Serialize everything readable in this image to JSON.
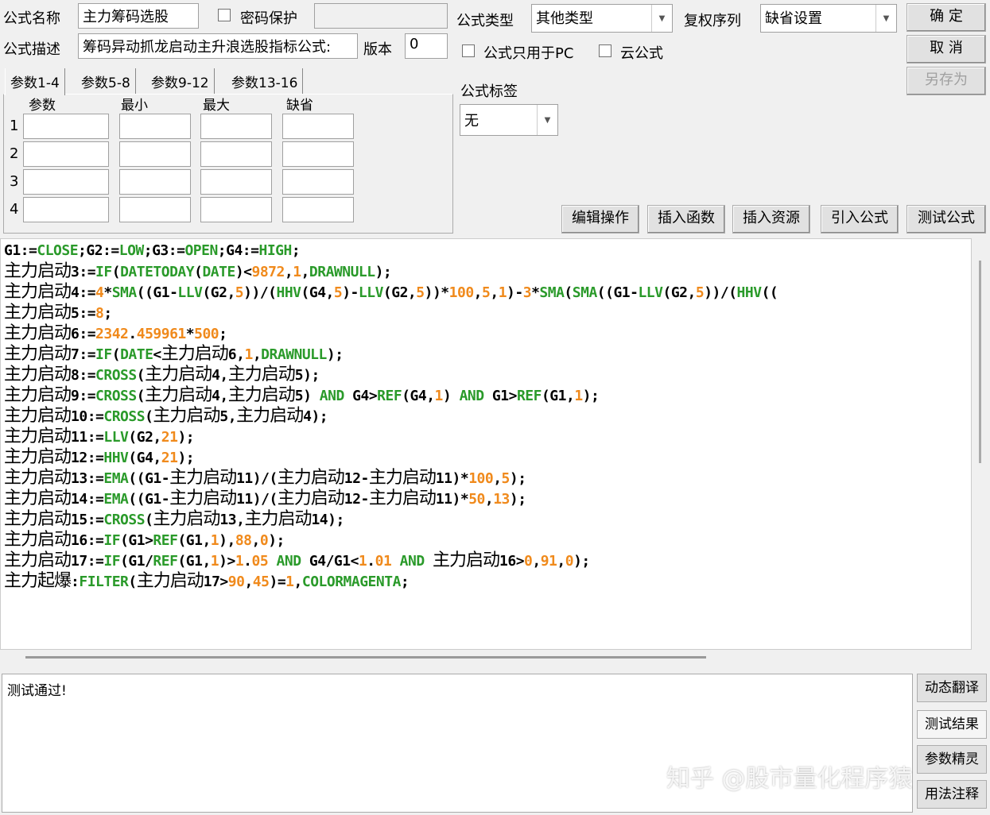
{
  "header": {
    "name_label": "公式名称",
    "name_value": "主力筹码选股",
    "password_label": "密码保护",
    "password_value": "",
    "desc_label": "公式描述",
    "desc_value": "筹码异动抓龙启动主升浪选股指标公式:",
    "version_label": "版本",
    "version_value": "0",
    "type_label": "公式类型",
    "type_value": "其他类型",
    "restore_label": "复权序列",
    "restore_value": "缺省设置",
    "pc_only_label": "公式只用于PC",
    "cloud_label": "云公式",
    "tag_label": "公式标签",
    "tag_value": "无",
    "ok": "确 定",
    "cancel": "取 消",
    "save_as": "另存为"
  },
  "params": {
    "tabs": [
      "参数1-4",
      "参数5-8",
      "参数9-12",
      "参数13-16"
    ],
    "columns": [
      "参数",
      "最小",
      "最大",
      "缺省"
    ],
    "rows": [
      "1",
      "2",
      "3",
      "4"
    ]
  },
  "toolbar": [
    "编辑操作",
    "插入函数",
    "插入资源",
    "引入公式",
    "测试公式"
  ],
  "code": [
    [
      [
        "k",
        "G1:="
      ],
      [
        "f",
        "CLOSE"
      ],
      [
        "k",
        ";G2:="
      ],
      [
        "f",
        "LOW"
      ],
      [
        "k",
        ";G3:="
      ],
      [
        "f",
        "OPEN"
      ],
      [
        "k",
        ";G4:="
      ],
      [
        "f",
        "HIGH"
      ],
      [
        "k",
        ";"
      ]
    ],
    [
      [
        "cn",
        "主力启动"
      ],
      [
        "k",
        "3:="
      ],
      [
        "f",
        "IF"
      ],
      [
        "k",
        "("
      ],
      [
        "f",
        "DATETODAY"
      ],
      [
        "k",
        "("
      ],
      [
        "f",
        "DATE"
      ],
      [
        "k",
        ")<"
      ],
      [
        "n",
        "9872"
      ],
      [
        "k",
        ","
      ],
      [
        "n",
        "1"
      ],
      [
        "k",
        ","
      ],
      [
        "f",
        "DRAWNULL"
      ],
      [
        "k",
        ");"
      ]
    ],
    [
      [
        "cn",
        "主力启动"
      ],
      [
        "k",
        "4:="
      ],
      [
        "n",
        "4"
      ],
      [
        "k",
        "*"
      ],
      [
        "f",
        "SMA"
      ],
      [
        "k",
        "((G1-"
      ],
      [
        "f",
        "LLV"
      ],
      [
        "k",
        "(G2,"
      ],
      [
        "n",
        "5"
      ],
      [
        "k",
        "))/("
      ],
      [
        "f",
        "HHV"
      ],
      [
        "k",
        "(G4,"
      ],
      [
        "n",
        "5"
      ],
      [
        "k",
        ")-"
      ],
      [
        "f",
        "LLV"
      ],
      [
        "k",
        "(G2,"
      ],
      [
        "n",
        "5"
      ],
      [
        "k",
        "))*"
      ],
      [
        "n",
        "100"
      ],
      [
        "k",
        ","
      ],
      [
        "n",
        "5"
      ],
      [
        "k",
        ","
      ],
      [
        "n",
        "1"
      ],
      [
        "k",
        ")-"
      ],
      [
        "n",
        "3"
      ],
      [
        "k",
        "*"
      ],
      [
        "f",
        "SMA"
      ],
      [
        "k",
        "("
      ],
      [
        "f",
        "SMA"
      ],
      [
        "k",
        "((G1-"
      ],
      [
        "f",
        "LLV"
      ],
      [
        "k",
        "(G2,"
      ],
      [
        "n",
        "5"
      ],
      [
        "k",
        "))/("
      ],
      [
        "f",
        "HHV"
      ],
      [
        "k",
        "(("
      ]
    ],
    [
      [
        "cn",
        "主力启动"
      ],
      [
        "k",
        "5:="
      ],
      [
        "n",
        "8"
      ],
      [
        "k",
        ";"
      ]
    ],
    [
      [
        "cn",
        "主力启动"
      ],
      [
        "k",
        "6:="
      ],
      [
        "n",
        "2342"
      ],
      [
        "k",
        "."
      ],
      [
        "n",
        "459961"
      ],
      [
        "k",
        "*"
      ],
      [
        "n",
        "500"
      ],
      [
        "k",
        ";"
      ]
    ],
    [
      [
        "cn",
        "主力启动"
      ],
      [
        "k",
        "7:="
      ],
      [
        "f",
        "IF"
      ],
      [
        "k",
        "("
      ],
      [
        "f",
        "DATE"
      ],
      [
        "k",
        "<"
      ],
      [
        "cn",
        "主力启动"
      ],
      [
        "k",
        "6,"
      ],
      [
        "n",
        "1"
      ],
      [
        "k",
        ","
      ],
      [
        "f",
        "DRAWNULL"
      ],
      [
        "k",
        ");"
      ]
    ],
    [
      [
        "cn",
        "主力启动"
      ],
      [
        "k",
        "8:="
      ],
      [
        "f",
        "CROSS"
      ],
      [
        "k",
        "("
      ],
      [
        "cn",
        "主力启动"
      ],
      [
        "k",
        "4,"
      ],
      [
        "cn",
        "主力启动"
      ],
      [
        "k",
        "5);"
      ]
    ],
    [
      [
        "cn",
        "主力启动"
      ],
      [
        "k",
        "9:="
      ],
      [
        "f",
        "CROSS"
      ],
      [
        "k",
        "("
      ],
      [
        "cn",
        "主力启动"
      ],
      [
        "k",
        "4,"
      ],
      [
        "cn",
        "主力启动"
      ],
      [
        "k",
        "5) "
      ],
      [
        "f",
        "AND"
      ],
      [
        "k",
        " G4>"
      ],
      [
        "f",
        "REF"
      ],
      [
        "k",
        "(G4,"
      ],
      [
        "n",
        "1"
      ],
      [
        "k",
        ") "
      ],
      [
        "f",
        "AND"
      ],
      [
        "k",
        " G1>"
      ],
      [
        "f",
        "REF"
      ],
      [
        "k",
        "(G1,"
      ],
      [
        "n",
        "1"
      ],
      [
        "k",
        ");"
      ]
    ],
    [
      [
        "cn",
        "主力启动"
      ],
      [
        "k",
        "10:="
      ],
      [
        "f",
        "CROSS"
      ],
      [
        "k",
        "("
      ],
      [
        "cn",
        "主力启动"
      ],
      [
        "k",
        "5,"
      ],
      [
        "cn",
        "主力启动"
      ],
      [
        "k",
        "4);"
      ]
    ],
    [
      [
        "cn",
        "主力启动"
      ],
      [
        "k",
        "11:="
      ],
      [
        "f",
        "LLV"
      ],
      [
        "k",
        "(G2,"
      ],
      [
        "n",
        "21"
      ],
      [
        "k",
        ");"
      ]
    ],
    [
      [
        "cn",
        "主力启动"
      ],
      [
        "k",
        "12:="
      ],
      [
        "f",
        "HHV"
      ],
      [
        "k",
        "(G4,"
      ],
      [
        "n",
        "21"
      ],
      [
        "k",
        ");"
      ]
    ],
    [
      [
        "cn",
        "主力启动"
      ],
      [
        "k",
        "13:="
      ],
      [
        "f",
        "EMA"
      ],
      [
        "k",
        "((G1-"
      ],
      [
        "cn",
        "主力启动"
      ],
      [
        "k",
        "11)/("
      ],
      [
        "cn",
        "主力启动"
      ],
      [
        "k",
        "12-"
      ],
      [
        "cn",
        "主力启动"
      ],
      [
        "k",
        "11)*"
      ],
      [
        "n",
        "100"
      ],
      [
        "k",
        ","
      ],
      [
        "n",
        "5"
      ],
      [
        "k",
        ");"
      ]
    ],
    [
      [
        "cn",
        "主力启动"
      ],
      [
        "k",
        "14:="
      ],
      [
        "f",
        "EMA"
      ],
      [
        "k",
        "((G1-"
      ],
      [
        "cn",
        "主力启动"
      ],
      [
        "k",
        "11)/("
      ],
      [
        "cn",
        "主力启动"
      ],
      [
        "k",
        "12-"
      ],
      [
        "cn",
        "主力启动"
      ],
      [
        "k",
        "11)*"
      ],
      [
        "n",
        "50"
      ],
      [
        "k",
        ","
      ],
      [
        "n",
        "13"
      ],
      [
        "k",
        ");"
      ]
    ],
    [
      [
        "cn",
        "主力启动"
      ],
      [
        "k",
        "15:="
      ],
      [
        "f",
        "CROSS"
      ],
      [
        "k",
        "("
      ],
      [
        "cn",
        "主力启动"
      ],
      [
        "k",
        "13,"
      ],
      [
        "cn",
        "主力启动"
      ],
      [
        "k",
        "14);"
      ]
    ],
    [
      [
        "cn",
        "主力启动"
      ],
      [
        "k",
        "16:="
      ],
      [
        "f",
        "IF"
      ],
      [
        "k",
        "(G1>"
      ],
      [
        "f",
        "REF"
      ],
      [
        "k",
        "(G1,"
      ],
      [
        "n",
        "1"
      ],
      [
        "k",
        "),"
      ],
      [
        "n",
        "88"
      ],
      [
        "k",
        ","
      ],
      [
        "n",
        "0"
      ],
      [
        "k",
        ");"
      ]
    ],
    [
      [
        "cn",
        "主力启动"
      ],
      [
        "k",
        "17:="
      ],
      [
        "f",
        "IF"
      ],
      [
        "k",
        "(G1/"
      ],
      [
        "f",
        "REF"
      ],
      [
        "k",
        "(G1,"
      ],
      [
        "n",
        "1"
      ],
      [
        "k",
        ")>"
      ],
      [
        "n",
        "1"
      ],
      [
        "k",
        "."
      ],
      [
        "n",
        "05"
      ],
      [
        "k",
        " "
      ],
      [
        "f",
        "AND"
      ],
      [
        "k",
        " G4/G1<"
      ],
      [
        "n",
        "1"
      ],
      [
        "k",
        "."
      ],
      [
        "n",
        "01"
      ],
      [
        "k",
        " "
      ],
      [
        "f",
        "AND"
      ],
      [
        "k",
        " "
      ],
      [
        "cn",
        "主力启动"
      ],
      [
        "k",
        "16>"
      ],
      [
        "n",
        "0"
      ],
      [
        "k",
        ","
      ],
      [
        "n",
        "91"
      ],
      [
        "k",
        ","
      ],
      [
        "n",
        "0"
      ],
      [
        "k",
        ");"
      ]
    ],
    [
      [
        "cn",
        "主力起爆"
      ],
      [
        "k",
        ":"
      ],
      [
        "f",
        "FILTER"
      ],
      [
        "k",
        "("
      ],
      [
        "cn",
        "主力启动"
      ],
      [
        "k",
        "17>"
      ],
      [
        "n",
        "90"
      ],
      [
        "k",
        ","
      ],
      [
        "n",
        "45"
      ],
      [
        "k",
        ")="
      ],
      [
        "n",
        "1"
      ],
      [
        "k",
        ","
      ],
      [
        "f",
        "COLORMAGENTA"
      ],
      [
        "k",
        ";"
      ]
    ]
  ],
  "message": "测试通过!",
  "side_buttons": [
    "动态翻译",
    "测试结果",
    "参数精灵",
    "用法注释"
  ],
  "watermark": "知乎 @股市量化程序猿"
}
